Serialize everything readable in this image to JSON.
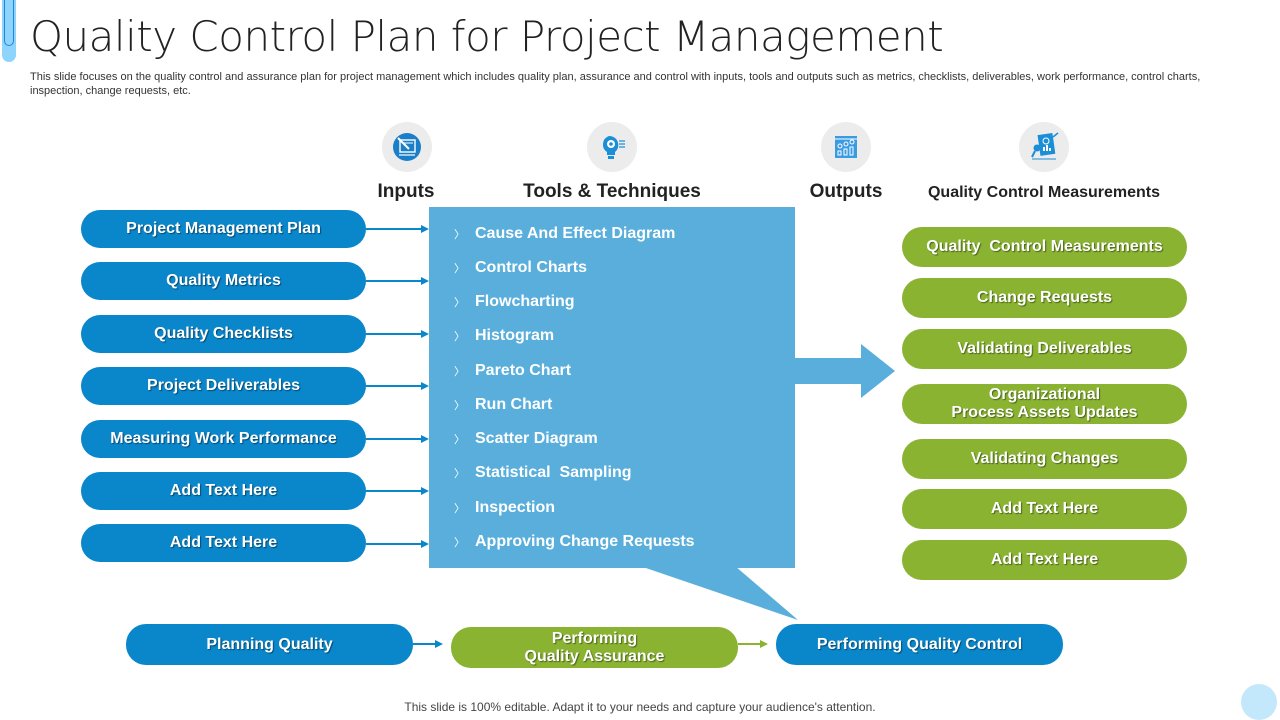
{
  "header": {
    "title": "Quality Control Plan for Project Management",
    "subtitle": "This slide focuses on the quality control and assurance plan for project management which includes quality plan, assurance and control with inputs, tools and outputs such as metrics, checklists, deliverables, work performance, control charts, inspection, change requests, etc."
  },
  "columns": [
    {
      "label": "Inputs",
      "icon": "project-plan-icon"
    },
    {
      "label": "Tools & Techniques",
      "icon": "lightbulb-gear-icon"
    },
    {
      "label": "Outputs",
      "icon": "dashboard-chart-icon"
    },
    {
      "label": "Quality Control Measurements",
      "icon": "report-analysis-icon"
    }
  ],
  "inputs": [
    "Project Management Plan",
    "Quality Metrics",
    "Quality Checklists",
    "Project Deliverables",
    "Measuring Work Performance",
    "Add Text Here",
    "Add Text Here"
  ],
  "tools": [
    "Cause And Effect Diagram",
    "Control Charts",
    "Flowcharting",
    "Histogram",
    "Pareto Chart",
    "Run Chart",
    "Scatter Diagram",
    "Statistical  Sampling",
    "Inspection",
    "Approving Change Requests"
  ],
  "tool_bullet": "〉",
  "outputs": [
    "Quality  Control Measurements",
    "Change Requests",
    "Validating Deliverables",
    "Organizational\nProcess Assets Updates",
    "Validating Changes",
    "Add Text Here",
    "Add Text Here"
  ],
  "process": [
    {
      "label": "Planning Quality",
      "color": "blue"
    },
    {
      "label": "Performing\nQuality Assurance",
      "color": "green"
    },
    {
      "label": "Performing Quality Control",
      "color": "blue"
    }
  ],
  "footer": "This slide is 100% editable. Adapt it to your needs and capture your audience's attention.",
  "colors": {
    "primary_blue": "#0a86cb",
    "light_blue": "#59aedc",
    "green": "#89b331",
    "accent_light": "#8fd3ff"
  }
}
